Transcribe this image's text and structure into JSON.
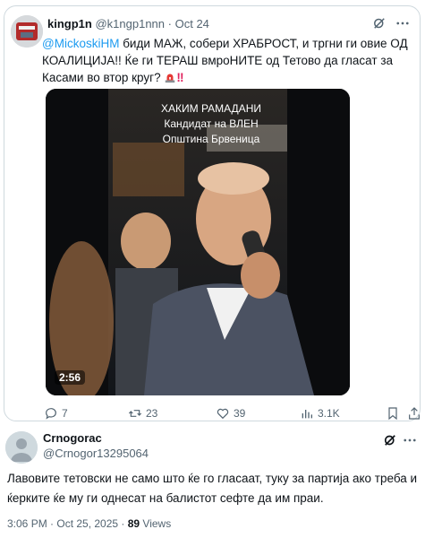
{
  "quoted_tweet": {
    "display_name": "kingp1n",
    "handle": "@k1ngp1nnn",
    "separator": "·",
    "date": "Oct 24",
    "mention": "@MickoskiHM",
    "text_main": " биди МАЖ, собери ХРАБРОСТ, и тргни ги овие ОД КОАЛИЦИЈА!! Ќе ги ТЕРАШ вмроНИТЕ од Тетово да гласат за Касами во втор круг?",
    "text_bang": "‼",
    "video": {
      "caption_line1": "ХАКИМ РАМАДАНИ",
      "caption_line2": "Кандидат на ВЛЕН",
      "caption_line3": "Општина Брвеница",
      "duration": "2:56"
    },
    "actions": {
      "replies": "7",
      "retweets": "23",
      "likes": "39",
      "views": "3.1K"
    },
    "icons": [
      "grok-icon",
      "more-icon",
      "reply-icon",
      "retweet-icon",
      "like-icon",
      "views-icon",
      "bookmark-icon",
      "share-icon"
    ]
  },
  "reply_tweet": {
    "display_name": "Crnogorac",
    "handle": "@Crnogor13295064",
    "text": "Лавовите тетовски не само што ќе го гласаат, туку за партија ако треба и ќерките ќе му ги однесат на балистот сефте да им праи.",
    "time": "3:06 PM · Oct 25, 2025 · ",
    "views_count": "89",
    "views_label": " Views"
  },
  "colors": {
    "link": "#1d9bf0",
    "secondary_text": "#536471",
    "border": "#cfd9de"
  }
}
